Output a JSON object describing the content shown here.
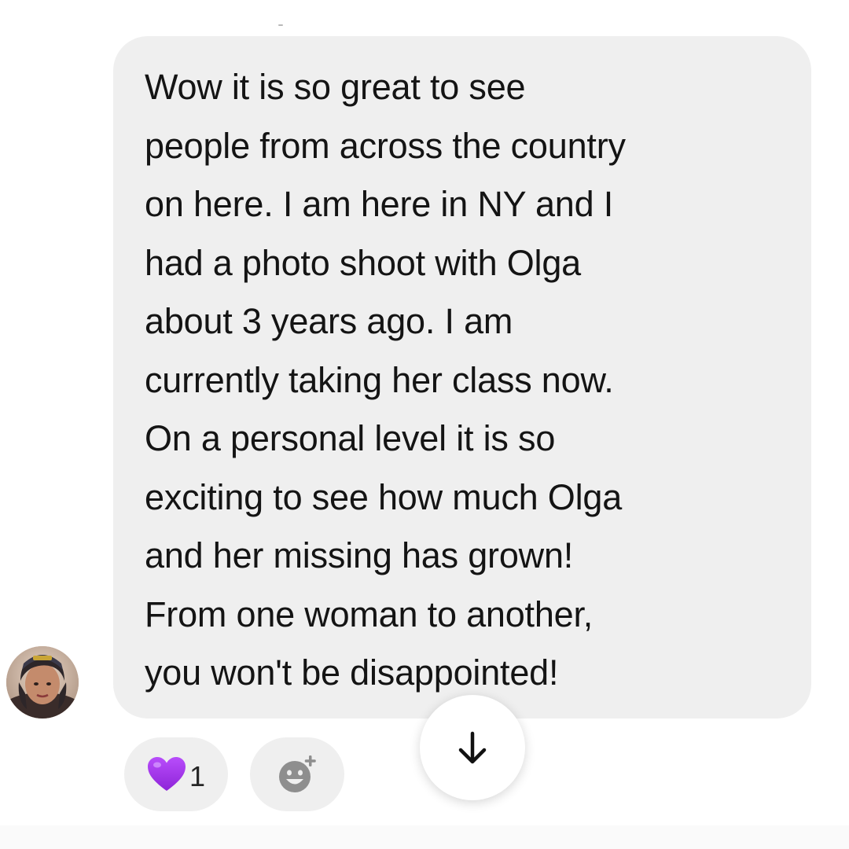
{
  "message": {
    "text": "Wow it is so great to see\npeople from across the country\non here. I am here in NY and I\nhad a photo shoot with Olga\nabout 3 years ago. I am\ncurrently taking her class now.\nOn a personal level it is so\nexciting to see how much Olga\nand her missing has grown!\nFrom one woman to another,\nyou won't be disappointed!"
  },
  "reactions": {
    "heart": {
      "emoji": "purple-heart",
      "count": "1",
      "color": "#a63bf2"
    },
    "add_reaction_icon": "add-reaction-smiley-icon"
  },
  "scroll_button": {
    "icon": "arrow-down-icon"
  },
  "colors": {
    "bubble_background": "#efefef",
    "text": "#141414",
    "reaction_pill": "#efefef"
  }
}
